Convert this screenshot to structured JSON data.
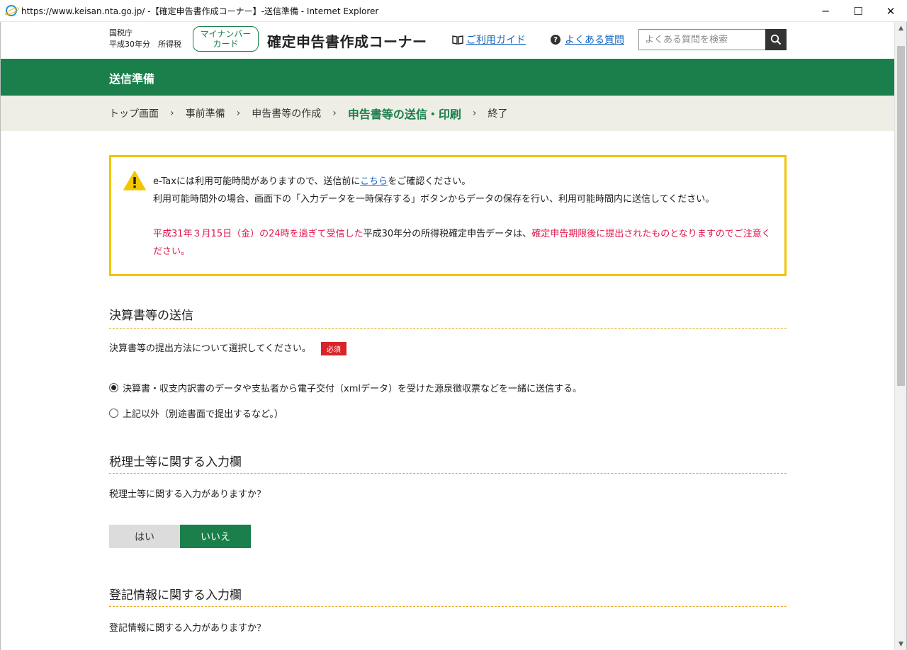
{
  "window": {
    "title": "https://www.keisan.nta.go.jp/ -【確定申告書作成コーナー】-送信準備 - Internet Explorer",
    "minimize": "─",
    "maximize": "☐",
    "close": "✕"
  },
  "header": {
    "agency_line1": "国税庁",
    "agency_line2": "平成30年分　所得税",
    "mynumber_line1": "マイナンバー",
    "mynumber_line2": "カード",
    "site_title": "確定申告書作成コーナー",
    "guide_link": "ご利用ガイド",
    "faq_link": "よくある質問",
    "faq_icon_glyph": "?",
    "search_placeholder": "よくある質問を検索"
  },
  "page_title": "送信準備",
  "breadcrumb": [
    {
      "label": "トップ画面"
    },
    {
      "label": "事前準備"
    },
    {
      "label": "申告書等の作成"
    },
    {
      "label": "申告書等の送信・印刷"
    },
    {
      "label": "終了"
    }
  ],
  "breadcrumb_sep": "›",
  "warning": {
    "line1_pre": "e-Taxには利用可能時間がありますので、送信前に",
    "line1_link": "こちら",
    "line1_post": "をご確認ください。",
    "line2": "利用可能時間外の場合、画面下の「入力データを一時保存する」ボタンからデータの保存を行い、利用可能時間内に送信してください。",
    "p2_red1": "平成31年３月15日（金）の24時を過ぎて受信した",
    "p2_black": "平成30年分の所得税確定申告データは、",
    "p2_red2": "確定申告期限後に提出されたものとなりますのでご注意ください。"
  },
  "section_statements": {
    "title": "決算書等の送信",
    "question": "決算書等の提出方法について選択してください。",
    "required_badge": "必須",
    "options": [
      {
        "label": "決算書・収支内訳書のデータや支払者から電子交付（xmlデータ）を受けた源泉徴収票などを一緒に送信する。",
        "checked": true
      },
      {
        "label": "上記以外（別途書面で提出するなど。）",
        "checked": false
      }
    ]
  },
  "section_tax_accountant": {
    "title": "税理士等に関する入力欄",
    "question": "税理士等に関する入力がありますか？",
    "yes_label": "はい",
    "no_label": "いいえ",
    "selected": "いいえ"
  },
  "section_registry": {
    "title": "登記情報に関する入力欄",
    "question": "登記情報に関する入力がありますか？"
  }
}
